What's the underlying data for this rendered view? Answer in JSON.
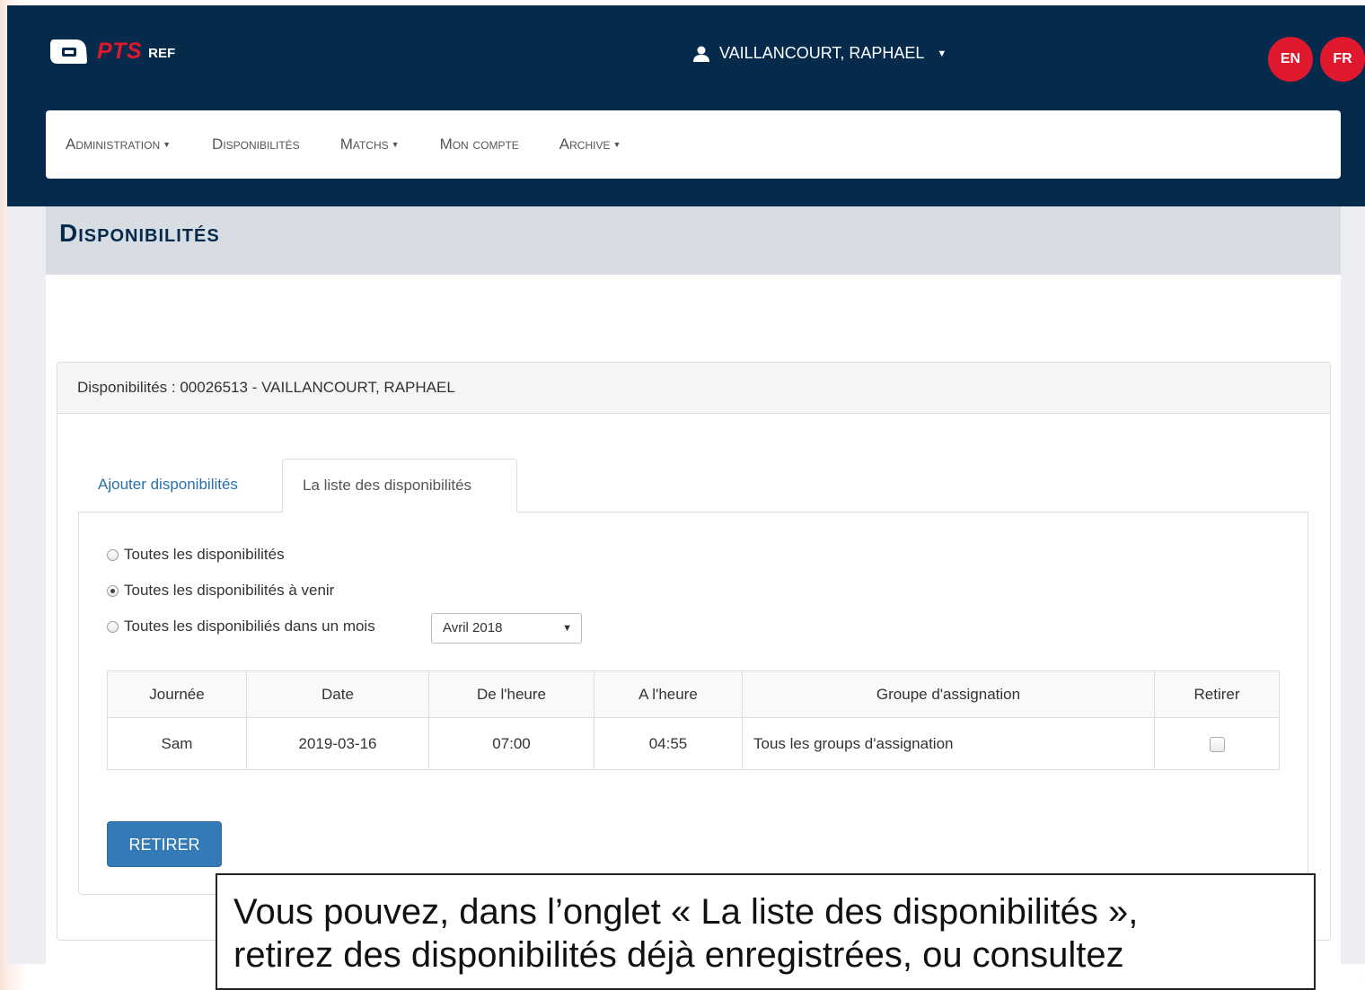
{
  "app": {
    "logo_text": "PTS",
    "logo_sub": "REF"
  },
  "user": {
    "name": "VAILLANCOURT, RAPHAEL"
  },
  "lang": {
    "en": "EN",
    "fr": "FR"
  },
  "nav": {
    "administration": "Administration",
    "disponibilites": "Disponibilités",
    "matchs": "Matchs",
    "mon_compte": "Mon compte",
    "archive": "Archive"
  },
  "page_title": "Disponibilités",
  "panel": {
    "heading": "Disponibilités : 00026513 - VAILLANCOURT, RAPHAEL"
  },
  "tabs": {
    "add": "Ajouter disponibilités",
    "list": "La liste des disponibilités"
  },
  "filters": {
    "all": "Toutes les disponibilités",
    "upcoming": "Toutes les disponibilités à venir",
    "month": "Toutes les disponibiliés dans un mois",
    "selected": "upcoming",
    "month_select_value": "Avril 2018"
  },
  "table": {
    "headers": [
      "Journée",
      "Date",
      "De l'heure",
      "A l'heure",
      "Groupe d'assignation",
      "Retirer"
    ],
    "rows": [
      {
        "day": "Sam",
        "date": "2019-03-16",
        "from": "07:00",
        "to": "04:55",
        "group": "Tous les groups d'assignation",
        "remove": false
      }
    ]
  },
  "button": {
    "remove": "RETIRER"
  },
  "callout": {
    "line1": "Vous pouvez, dans l’onglet « La liste des disponibilités »,",
    "line2": "retirez des disponibilités déjà enregistrées, ou consultez"
  },
  "colors": {
    "navy": "#052a4c",
    "brand_red": "#e0182d",
    "primary_blue": "#337ab7",
    "link": "#2a6fa8"
  },
  "icons": {
    "logo": "ticket-logo-icon",
    "user": "user-icon",
    "radio_selected": "upcoming"
  }
}
